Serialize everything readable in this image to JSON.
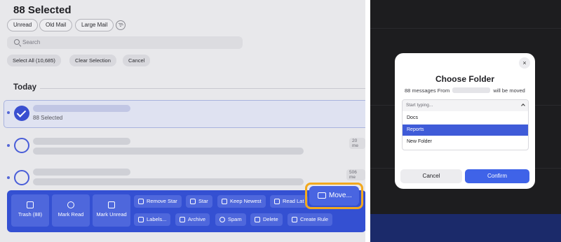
{
  "header": {
    "title": "88 Selected"
  },
  "filters": [
    "Unread",
    "Old Mail",
    "Large Mail"
  ],
  "search": {
    "placeholder": "Search"
  },
  "selection": {
    "select_all": "Select All (10,685)",
    "clear": "Clear Selection",
    "cancel": "Cancel"
  },
  "list": {
    "section": "Today",
    "selected_row_text": "88 Selected",
    "row2_meta": "20 me",
    "row3_meta": "506 me"
  },
  "actions": {
    "trash": "Trash (88)",
    "mark_read": "Mark Read",
    "mark_unread": "Mark Unread",
    "remove_star": "Remove Star",
    "star": "Star",
    "keep_newest": "Keep Newest",
    "read_later": "Read Lat",
    "labels": "Labels...",
    "archive": "Archive",
    "spam": "Spam",
    "delete": "Delete",
    "create_rule": "Create Rule",
    "move": "Move..."
  },
  "modal": {
    "close": "×",
    "title": "Choose Folder",
    "subtitle_prefix": "88 messages From",
    "subtitle_suffix": "will be moved",
    "dropdown_placeholder": "Start typing...",
    "folders": [
      "Docs",
      "Reports",
      "New Folder"
    ],
    "selected_folder": "Reports",
    "cancel": "Cancel",
    "confirm": "Confirm"
  },
  "colors": {
    "accent": "#3450d2",
    "highlight": "#f2a91e",
    "confirm": "#3f63e8"
  }
}
